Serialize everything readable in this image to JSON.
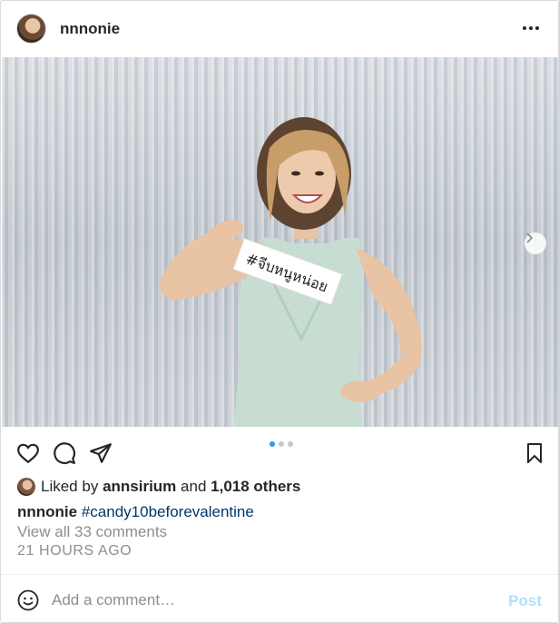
{
  "header": {
    "username": "nnnonie"
  },
  "photo": {
    "sign_text": "#จีบหนูหน่อย",
    "carousel_total": 3,
    "carousel_active": 1
  },
  "likes": {
    "prefix": "Liked by ",
    "user": "annsirium",
    "middle": " and ",
    "others": "1,018 others"
  },
  "caption": {
    "username": "nnnonie",
    "hashtag": "#candy10beforevalentine"
  },
  "comments": {
    "view_all": "View all 33 comments"
  },
  "timestamp": "21 HOURS AGO",
  "comment_box": {
    "placeholder": "Add a comment…",
    "post_label": "Post"
  },
  "colors": {
    "link": "#00376b",
    "muted": "#8e8e8e",
    "post_disabled": "#b2dffc",
    "carousel_active": "#3897f0"
  }
}
